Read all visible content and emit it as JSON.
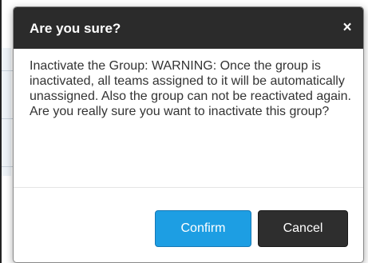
{
  "dialog": {
    "title": "Are you sure?",
    "close_glyph": "×",
    "close_icon": "close-icon",
    "message": "Inactivate the Group: WARNING: Once the group is inactivated, all teams assigned to it will be automatically unassigned. Also the group can not be reactivated again. Are you really sure you want to inactivate this group?",
    "confirm_label": "Confirm",
    "cancel_label": "Cancel"
  },
  "colors": {
    "header_bg": "#2b2b2b",
    "confirm_bg": "#1d9ee3",
    "cancel_bg": "#2e2e2e"
  }
}
